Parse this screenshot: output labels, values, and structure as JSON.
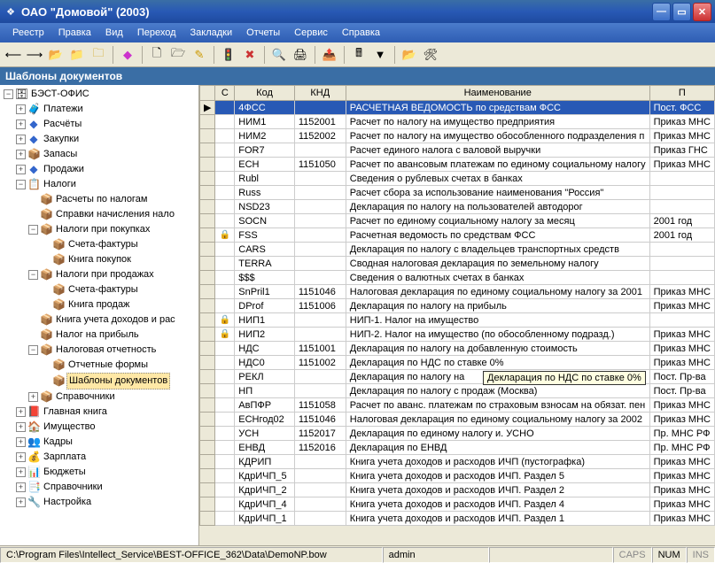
{
  "window": {
    "title": "ОАО \"Домовой\" (2003)"
  },
  "menus": [
    "Реестр",
    "Правка",
    "Вид",
    "Переход",
    "Закладки",
    "Отчеты",
    "Сервис",
    "Справка"
  ],
  "panel_title": "Шаблоны документов",
  "tree": {
    "root": "БЭСТ-ОФИС",
    "n1": "Платежи",
    "n2": "Расчёты",
    "n3": "Закупки",
    "n4": "Запасы",
    "n5": "Продажи",
    "n6": "Налоги",
    "n6a": "Расчеты по налогам",
    "n6b": "Справки начисления нало",
    "n6c": "Налоги при покупках",
    "n6c1": "Счета-фактуры",
    "n6c2": "Книга покупок",
    "n6d": "Налоги при продажах",
    "n6d1": "Счета-фактуры",
    "n6d2": "Книга продаж",
    "n6e": "Книга учета доходов и рас",
    "n6f": "Налог на прибыль",
    "n6g": "Налоговая отчетность",
    "n6g1": "Отчетные формы",
    "n6g2": "Шаблоны документов",
    "n6h": "Справочники",
    "n7": "Главная книга",
    "n8": "Имущество",
    "n9": "Кадры",
    "n10": "Зарплата",
    "n11": "Бюджеты",
    "n12": "Справочники",
    "n13": "Настройка"
  },
  "columns": {
    "c1": "С",
    "c2": "Код",
    "c3": "КНД",
    "c4": "Наименование",
    "c5": "П"
  },
  "rows": [
    {
      "lock": "",
      "code": "4ФСС",
      "knd": "",
      "name": "РАСЧЕТНАЯ ВЕДОМОСТЬ по средствам ФСС",
      "p": "Пост. ФСС"
    },
    {
      "lock": "",
      "code": "НИМ1",
      "knd": "1152001",
      "name": "Расчет по налогу на имущество предприятия",
      "p": "Приказ МНС"
    },
    {
      "lock": "",
      "code": "НИМ2",
      "knd": "1152002",
      "name": "Расчет по налогу на имущество обособленного подразделения п",
      "p": "Приказ МНС"
    },
    {
      "lock": "",
      "code": "FOR7",
      "knd": "",
      "name": "Расчет единого налога с валовой выручки",
      "p": "Приказ ГНС"
    },
    {
      "lock": "",
      "code": "ЕСН",
      "knd": "1151050",
      "name": "Расчет по авансовым платежам по единому социальному налогу",
      "p": "Приказ МНС"
    },
    {
      "lock": "",
      "code": "Rubl",
      "knd": "",
      "name": "Сведения о рублевых счетах в банках",
      "p": ""
    },
    {
      "lock": "",
      "code": "Russ",
      "knd": "",
      "name": "Расчет сбора за использование наименования \"Россия\"",
      "p": ""
    },
    {
      "lock": "",
      "code": "NSD23",
      "knd": "",
      "name": "Декларация по налогу на пользователей автодорог",
      "p": ""
    },
    {
      "lock": "",
      "code": "SOCN",
      "knd": "",
      "name": "Расчет по единому социальному налогу за месяц",
      "p": "2001 год"
    },
    {
      "lock": "🔒",
      "code": "FSS",
      "knd": "",
      "name": "Расчетная ведомость по средствам ФСС",
      "p": "2001 год"
    },
    {
      "lock": "",
      "code": "CARS",
      "knd": "",
      "name": "Декларация по налогу с владельцев транспортных средств",
      "p": ""
    },
    {
      "lock": "",
      "code": "TERRA",
      "knd": "",
      "name": "Сводная налоговая декларация по земельному налогу",
      "p": ""
    },
    {
      "lock": "",
      "code": "$$$",
      "knd": "",
      "name": "Сведения о валютных счетах в банках",
      "p": ""
    },
    {
      "lock": "",
      "code": "SnPril1",
      "knd": "1151046",
      "name": "Налоговая декларация по единому социальному налогу за 2001",
      "p": "Приказ МНС"
    },
    {
      "lock": "",
      "code": "DProf",
      "knd": "1151006",
      "name": "Декларация по налогу на прибыль",
      "p": "Приказ МНС"
    },
    {
      "lock": "🔒",
      "code": "НИП1",
      "knd": "",
      "name": "НИП-1. Налог на имущество",
      "p": ""
    },
    {
      "lock": "🔒",
      "code": "НИП2",
      "knd": "",
      "name": "НИП-2. Налог на имущество (по обособленному подразд.)",
      "p": "Приказ МНС"
    },
    {
      "lock": "",
      "code": "НДС",
      "knd": "1151001",
      "name": "Декларация по налогу на добавленную стоимость",
      "p": "Приказ МНС"
    },
    {
      "lock": "",
      "code": "НДС0",
      "knd": "1151002",
      "name": "Декларация по НДС по ставке 0%",
      "p": "Приказ МНС"
    },
    {
      "lock": "",
      "code": "РЕКЛ",
      "knd": "",
      "name": "Декларация по налогу на",
      "p": "Пост. Пр-ва"
    },
    {
      "lock": "",
      "code": "НП",
      "knd": "",
      "name": "Декларация по налогу с продаж (Москва)",
      "p": "Пост. Пр-ва"
    },
    {
      "lock": "",
      "code": "АвПФР",
      "knd": "1151058",
      "name": "Расчет по аванс. платежам по страховым взносам на обязат. пен",
      "p": "Приказ МНС"
    },
    {
      "lock": "",
      "code": "ЕСНгод02",
      "knd": "1151046",
      "name": "Налоговая декларация по единому социальному налогу за 2002",
      "p": "Приказ МНС"
    },
    {
      "lock": "",
      "code": "УСН",
      "knd": "1152017",
      "name": "Декларация по единому налогу и. УСНО",
      "p": "Пр. МНС РФ"
    },
    {
      "lock": "",
      "code": "ЕНВД",
      "knd": "1152016",
      "name": "Декларация по ЕНВД",
      "p": "Пр. МНС РФ"
    },
    {
      "lock": "",
      "code": "КДРИП",
      "knd": "",
      "name": "Книга учета доходов и расходов ИЧП (пустографка)",
      "p": "Приказ МНС"
    },
    {
      "lock": "",
      "code": "КдрИЧП_5",
      "knd": "",
      "name": "Книга учета доходов и расходов ИЧП. Раздел 5",
      "p": "Приказ МНС"
    },
    {
      "lock": "",
      "code": "КдрИЧП_2",
      "knd": "",
      "name": "Книга учета доходов и расходов ИЧП. Раздел 2",
      "p": "Приказ МНС"
    },
    {
      "lock": "",
      "code": "КдрИЧП_4",
      "knd": "",
      "name": "Книга учета доходов и расходов ИЧП. Раздел 4",
      "p": "Приказ МНС"
    },
    {
      "lock": "",
      "code": "КдрИЧП_1",
      "knd": "",
      "name": "Книга учета доходов и расходов ИЧП. Раздел 1",
      "p": "Приказ МНС"
    }
  ],
  "tooltip": "Декларация по НДС по ставке 0%",
  "status": {
    "path": "C:\\Program Files\\Intellect_Service\\BEST-OFFICE_362\\Data\\DemoNP.bow",
    "user": "admin",
    "caps": "CAPS",
    "num": "NUM",
    "ins": "INS"
  }
}
